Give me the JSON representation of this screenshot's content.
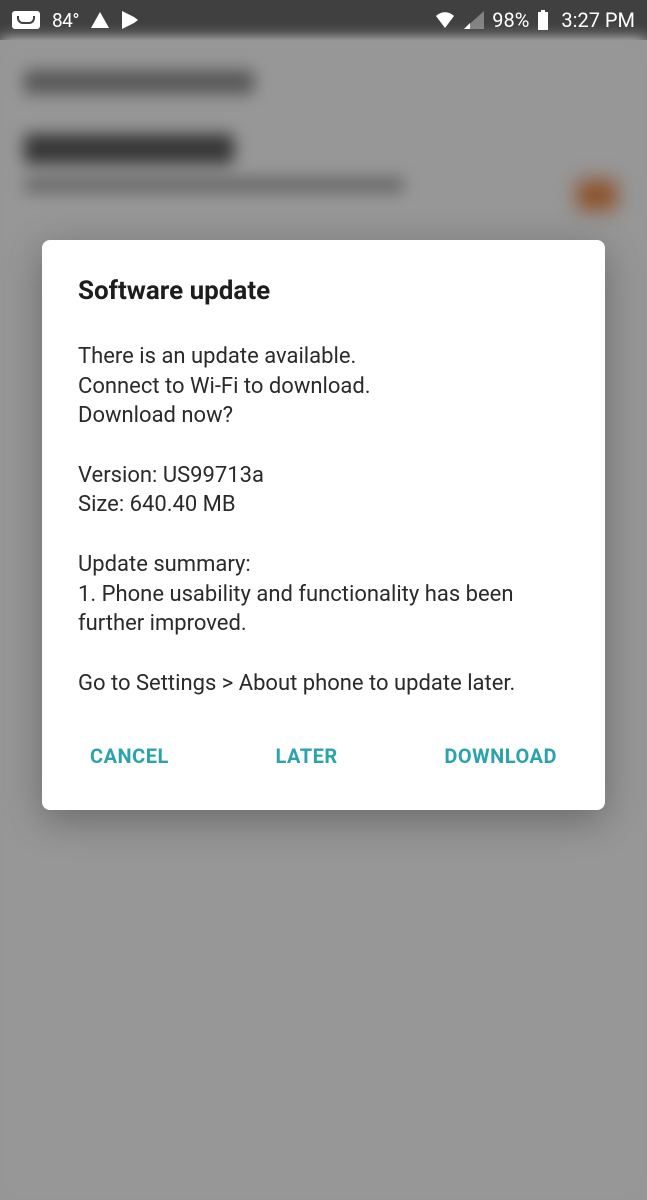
{
  "status_bar": {
    "temperature": " 84°",
    "battery_percent": "98%",
    "clock": "3:27 PM"
  },
  "dialog": {
    "title": "Software update",
    "body": "There is an update available.\nConnect to Wi-Fi to download.\nDownload now?\n\nVersion: US99713a\nSize: 640.40 MB\n\nUpdate summary:\n1. Phone usability and functionality has been further improved.\n\nGo to Settings > About phone to update later.",
    "buttons": {
      "cancel": "CANCEL",
      "later": "LATER",
      "download": "DOWNLOAD"
    }
  }
}
